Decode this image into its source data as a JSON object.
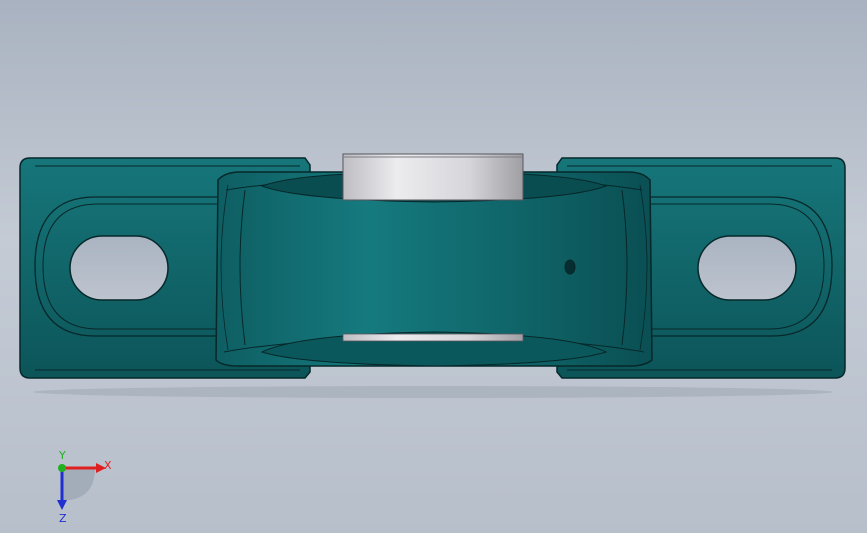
{
  "viewport": {
    "background_top": "#a9b2c0",
    "background_bottom": "#b7bfcb",
    "model_color": "#0d5f63",
    "edge_color": "#06282a",
    "insert_color": "#d9d9dd"
  },
  "triad": {
    "x_label": "X",
    "y_label": "Y",
    "z_label": "Z",
    "x_color": "#e02020",
    "y_color": "#20b020",
    "z_color": "#2030d0"
  }
}
